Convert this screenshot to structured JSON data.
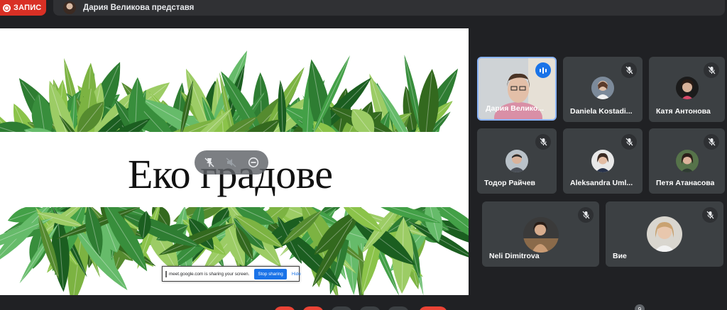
{
  "recording": {
    "label": "ЗАПИС",
    "color": "#d93025"
  },
  "presenter": {
    "text": "Дария Великова представя"
  },
  "slide": {
    "title": "Еко градове",
    "controls": [
      {
        "icon": "pin-off-icon"
      },
      {
        "icon": "volume-off-icon"
      },
      {
        "icon": "minimize-icon"
      }
    ]
  },
  "share_bar": {
    "text": "meet.google.com is sharing your screen.",
    "stop_label": "Stop sharing",
    "hide_label": "Hide"
  },
  "participants": [
    {
      "name": "Дария Велико...",
      "state": "speaking",
      "icon": "audio-level-icon"
    },
    {
      "name": "Daniela Kostadi...",
      "state": "muted",
      "icon": "mic-off-icon"
    },
    {
      "name": "Катя Антонова",
      "state": "muted",
      "icon": "mic-off-icon"
    },
    {
      "name": "Тодор Райчев",
      "state": "muted",
      "icon": "mic-off-icon"
    },
    {
      "name": "Aleksandra Uml...",
      "state": "muted",
      "icon": "mic-off-icon"
    },
    {
      "name": "Петя Атанасова",
      "state": "muted",
      "icon": "mic-off-icon"
    },
    {
      "name": "Neli Dimitrova",
      "state": "muted",
      "icon": "mic-off-icon"
    },
    {
      "name": "Вие",
      "state": "muted",
      "icon": "mic-off-icon"
    }
  ],
  "people_count": "9",
  "colors": {
    "accent": "#1a73e8",
    "tile_bg": "#3c4043",
    "page_bg": "#202124"
  }
}
